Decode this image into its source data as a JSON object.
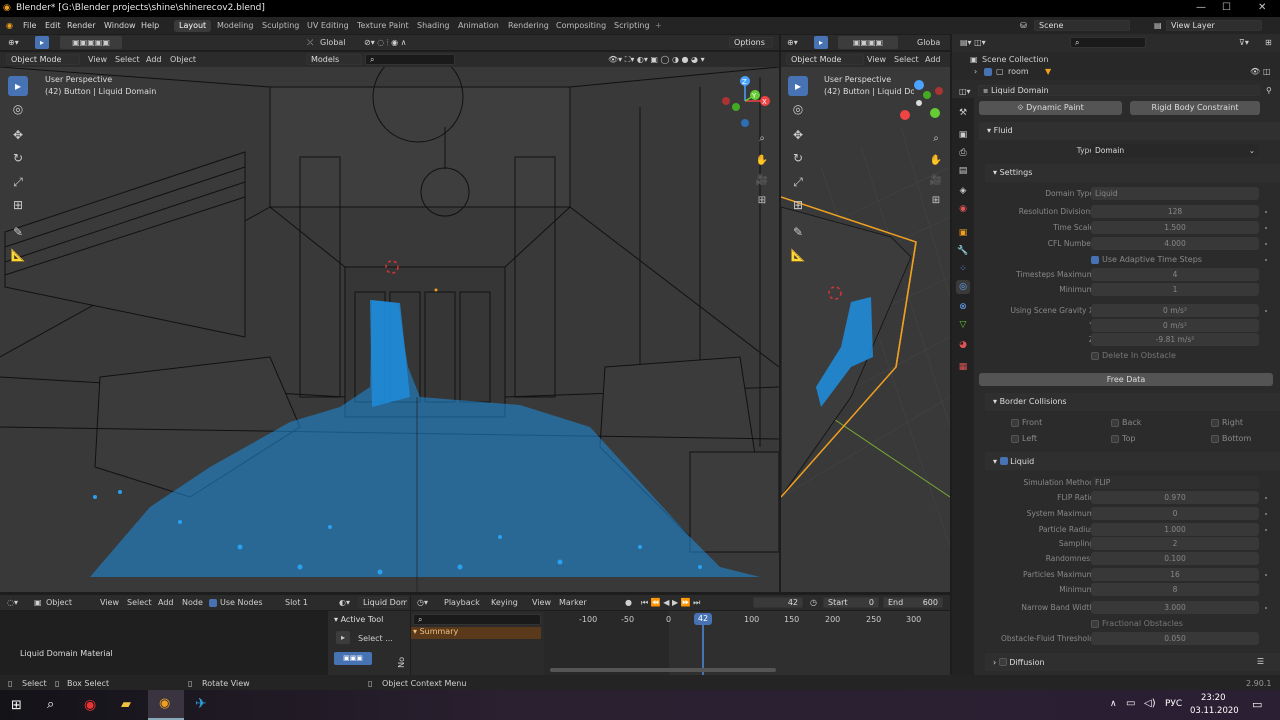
{
  "window": {
    "title": "Blender* [G:\\Blender projects\\shine\\shinerecov2.blend]",
    "minimize": "—",
    "maximize": "☐",
    "close": "✕"
  },
  "menu": {
    "items": [
      "File",
      "Edit",
      "Render",
      "Window",
      "Help"
    ]
  },
  "workspaces": [
    "Layout",
    "Modeling",
    "Sculpting",
    "UV Editing",
    "Texture Paint",
    "Shading",
    "Animation",
    "Rendering",
    "Compositing",
    "Scripting"
  ],
  "active_workspace": "Layout",
  "scene": {
    "name": "Scene",
    "view_layer": "View Layer"
  },
  "viewport1": {
    "transform": "Global",
    "options": "Options",
    "mode": "Object Mode",
    "menus": [
      "View",
      "Select",
      "Add",
      "Object"
    ],
    "collection": "Models",
    "perspective": "User Perspective",
    "object": "(42) Button | Liquid Domain"
  },
  "viewport2": {
    "transform": "Globa",
    "mode": "Object Mode",
    "menus": [
      "View",
      "Select",
      "Add"
    ],
    "perspective": "User Perspective",
    "object": "(42) Button | Liquid Domain"
  },
  "gizmo": {
    "x": "X",
    "y": "Y",
    "z": "Z"
  },
  "outliner": {
    "root": "Scene Collection",
    "item": "room"
  },
  "properties": {
    "object": "Liquid Domain",
    "physics_buttons": [
      "Dynamic Paint",
      "Rigid Body Constraint"
    ],
    "fluid": {
      "header": "Fluid",
      "type_label": "Type",
      "type_value": "Domain"
    },
    "settings": {
      "header": "Settings",
      "rows": [
        {
          "label": "Domain Type",
          "value": "Liquid"
        },
        {
          "label": "Resolution Divisions",
          "value": "128"
        },
        {
          "label": "Time Scale",
          "value": "1.500"
        },
        {
          "label": "CFL Number",
          "value": "4.000"
        }
      ],
      "adaptive": "Use Adaptive Time Steps",
      "rows2": [
        {
          "label": "Timesteps Maximum",
          "value": "4"
        },
        {
          "label": "Minimum",
          "value": "1"
        }
      ],
      "gravity": [
        {
          "label": "Using Scene Gravity X",
          "value": "0 m/s²"
        },
        {
          "label": "Y",
          "value": "0 m/s²"
        },
        {
          "label": "Z",
          "value": "-9.81 m/s²"
        }
      ],
      "delete_in_obstacle": "Delete In Obstacle",
      "free_data": "Free Data"
    },
    "border": {
      "header": "Border Collisions",
      "items": [
        "Front",
        "Back",
        "Right",
        "Left",
        "Top",
        "Bottom"
      ]
    },
    "liquid": {
      "header": "Liquid",
      "rows": [
        {
          "label": "Simulation Method",
          "value": "FLIP"
        },
        {
          "label": "FLIP Ratio",
          "value": "0.970"
        },
        {
          "label": "System Maximum",
          "value": "0"
        },
        {
          "label": "Particle Radius",
          "value": "1.000"
        },
        {
          "label": "Sampling",
          "value": "2"
        },
        {
          "label": "Randomness",
          "value": "0.100"
        },
        {
          "label": "Particles Maximum",
          "value": "16"
        },
        {
          "label": "Minimum",
          "value": "8"
        },
        {
          "label": "Narrow Band Width",
          "value": "3.000"
        }
      ],
      "fractional": "Fractional Obstacles",
      "obstacle_label": "Obstacle-Fluid Threshold",
      "obstacle_value": "0.050"
    },
    "diffusion": "Diffusion"
  },
  "node_editor": {
    "object": "Object",
    "menus": [
      "View",
      "Select",
      "Add",
      "Node"
    ],
    "use_nodes": "Use Nodes",
    "slot": "Slot 1",
    "material": "Liquid Doma",
    "label": "Liquid Domain Material"
  },
  "tool_panel": {
    "title": "Active Tool",
    "select": "Select ...",
    "tab": "No"
  },
  "timeline": {
    "menus": [
      "Playback",
      "Keying",
      "View",
      "Marker"
    ],
    "current_frame": "42",
    "start_label": "Start",
    "start": "0",
    "end_label": "End",
    "end": "600",
    "summary": "Summary",
    "ticks": [
      "-100",
      "-50",
      "0",
      "42",
      "100",
      "150",
      "200",
      "250",
      "300"
    ]
  },
  "status": {
    "select": "Select",
    "box_select": "Box Select",
    "rotate": "Rotate View",
    "context": "Object Context Menu",
    "version": "2.90.1"
  },
  "taskbar": {
    "lang": "РУС",
    "time": "23:20",
    "date": "03.11.2020"
  },
  "colors": {
    "accent": "#4772b3",
    "particles": "#1e8fe0",
    "active_orange": "#f0a020",
    "title_bg": "#000000"
  }
}
